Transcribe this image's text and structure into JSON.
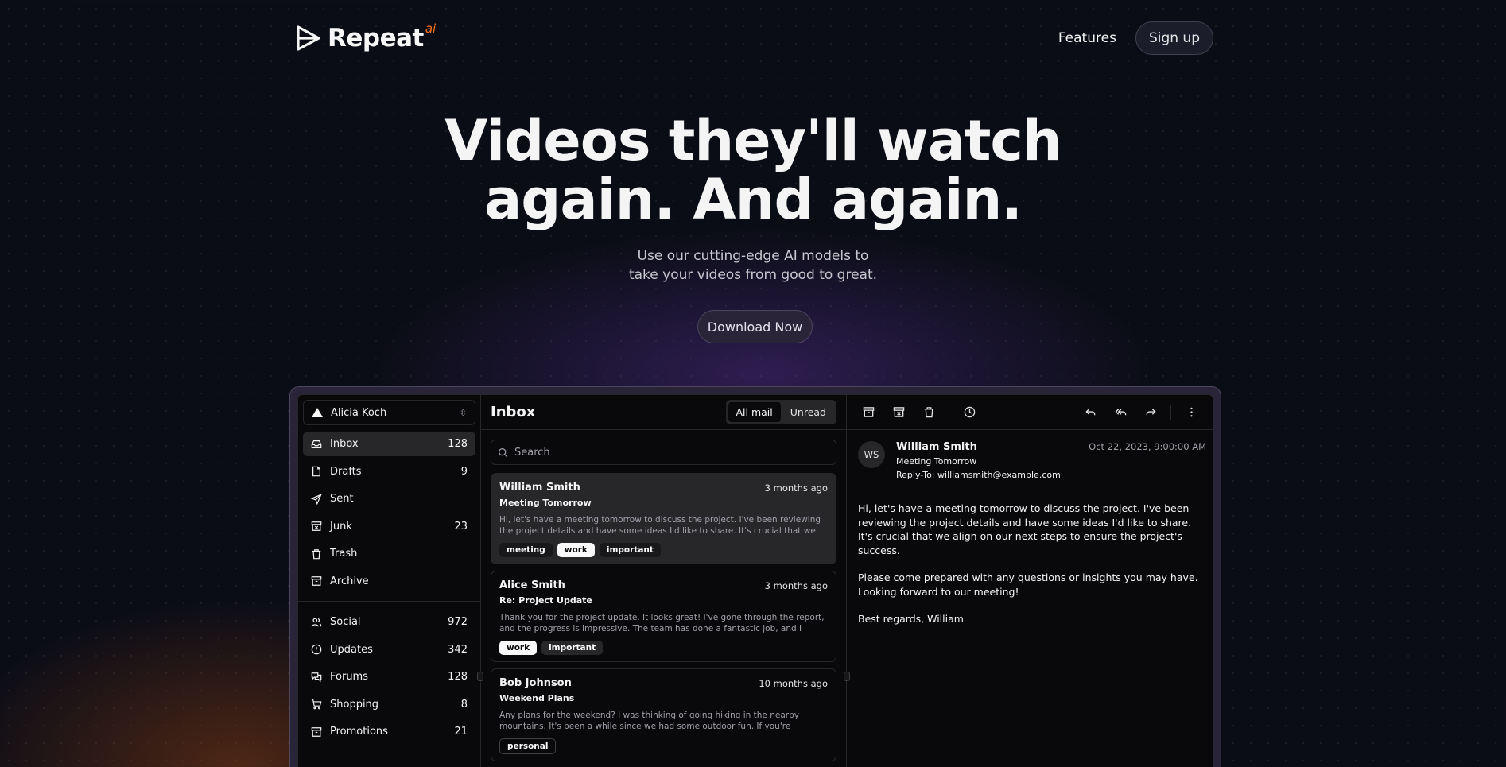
{
  "header": {
    "brand": "Repeat",
    "brand_suffix": "ai",
    "nav_features": "Features",
    "signup": "Sign up"
  },
  "hero": {
    "title_line1": "Videos they'll watch",
    "title_line2": "again. And again.",
    "sub_line1": "Use our cutting-edge AI models to",
    "sub_line2": "take your videos from good to great.",
    "cta": "Download Now"
  },
  "sidebar": {
    "account": "Alicia Koch",
    "primary": [
      {
        "label": "Inbox",
        "count": "128",
        "icon": "inbox-icon"
      },
      {
        "label": "Drafts",
        "count": "9",
        "icon": "file-icon"
      },
      {
        "label": "Sent",
        "count": "",
        "icon": "send-icon"
      },
      {
        "label": "Junk",
        "count": "23",
        "icon": "archive-x-icon"
      },
      {
        "label": "Trash",
        "count": "",
        "icon": "trash-icon"
      },
      {
        "label": "Archive",
        "count": "",
        "icon": "archive-icon"
      }
    ],
    "secondary": [
      {
        "label": "Social",
        "count": "972",
        "icon": "users-icon"
      },
      {
        "label": "Updates",
        "count": "342",
        "icon": "alert-circle-icon"
      },
      {
        "label": "Forums",
        "count": "128",
        "icon": "messages-icon"
      },
      {
        "label": "Shopping",
        "count": "8",
        "icon": "cart-icon"
      },
      {
        "label": "Promotions",
        "count": "21",
        "icon": "archive-icon"
      }
    ]
  },
  "list": {
    "title": "Inbox",
    "tab_all": "All mail",
    "tab_unread": "Unread",
    "search_placeholder": "Search",
    "mails": [
      {
        "from": "William Smith",
        "time": "3 months ago",
        "subject": "Meeting Tomorrow",
        "preview": "Hi, let's have a meeting tomorrow to discuss the project. I've been reviewing the project details and have some ideas I'd like to share. It's crucial that we align on our next steps to ensure the project's success.",
        "tags": [
          "meeting",
          "work",
          "important"
        ]
      },
      {
        "from": "Alice Smith",
        "time": "3 months ago",
        "subject": "Re: Project Update",
        "preview": "Thank you for the project update. It looks great! I've gone through the report, and the progress is impressive. The team has done a fantastic job, and I appreciate the hard work everyone has put in.",
        "tags": [
          "work",
          "important"
        ]
      },
      {
        "from": "Bob Johnson",
        "time": "10 months ago",
        "subject": "Weekend Plans",
        "preview": "Any plans for the weekend? I was thinking of going hiking in the nearby mountains. It's been a while since we had some outdoor fun. If you're interested, let me know, and we can plan the details.",
        "tags": [
          "personal"
        ]
      }
    ]
  },
  "reader": {
    "initials": "WS",
    "from": "William Smith",
    "subject": "Meeting Tomorrow",
    "reply_to": "Reply-To: williamsmith@example.com",
    "date": "Oct 22, 2023, 9:00:00 AM",
    "body_p1": "Hi, let's have a meeting tomorrow to discuss the project. I've been reviewing the project details and have some ideas I'd like to share. It's crucial that we align on our next steps to ensure the project's success.",
    "body_p2": "Please come prepared with any questions or insights you may have. Looking forward to our meeting!",
    "body_p3": "Best regards, William"
  }
}
